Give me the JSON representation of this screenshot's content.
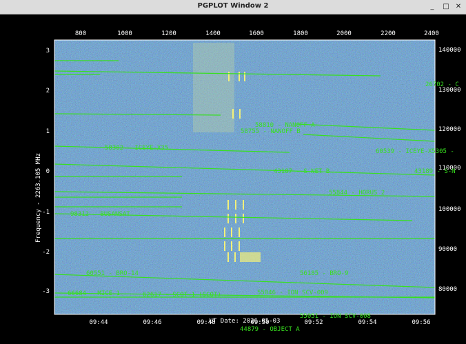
{
  "window": {
    "title": "PGPLOT Window 2",
    "controls": [
      "minimize-icon",
      "restore-icon",
      "close-icon"
    ]
  },
  "colors": {
    "background": "#000000",
    "plot_field": "#2f4f86",
    "trace": "#37e01f",
    "axis_text": "#ffffff"
  },
  "chart_data": {
    "type": "heatmap",
    "ylabel": "Frequency - 2263.105 MHz",
    "xlabel": "UT Date: 2026-05-03",
    "bottom_ticks": [
      "09:44",
      "09:46",
      "09:48",
      "09:50",
      "09:52",
      "09:54",
      "09:56"
    ],
    "top_ticks": [
      "800",
      "1000",
      "1200",
      "1400",
      "1600",
      "1800",
      "2000",
      "2200",
      "2400"
    ],
    "left_ticks": [
      "3",
      "2",
      "1",
      "0",
      "-1",
      "-2",
      "-3"
    ],
    "right_ticks": [
      "140000",
      "130000",
      "120000",
      "110000",
      "100000",
      "90000",
      "80000"
    ],
    "satellite_labels": [
      "58810 - NANOFF A",
      "58755 - NANOFF B",
      "58302 - ICEYE-X35",
      "60539 - ICEYE-X5305 -",
      "43187 - S-NET B",
      "43189 - S-N",
      "55844 - HORUS 2",
      "98312 - BUSANSAT",
      "60551 - BRO-14",
      "56185 - BRO-9",
      "66684 - MICE-1",
      "62617 - SCOT-1 (SCOT)",
      "55046 - ION SCV-009",
      "55051 - ION SCV-008",
      "44879 - OBJECT A",
      "26702 - C"
    ]
  }
}
